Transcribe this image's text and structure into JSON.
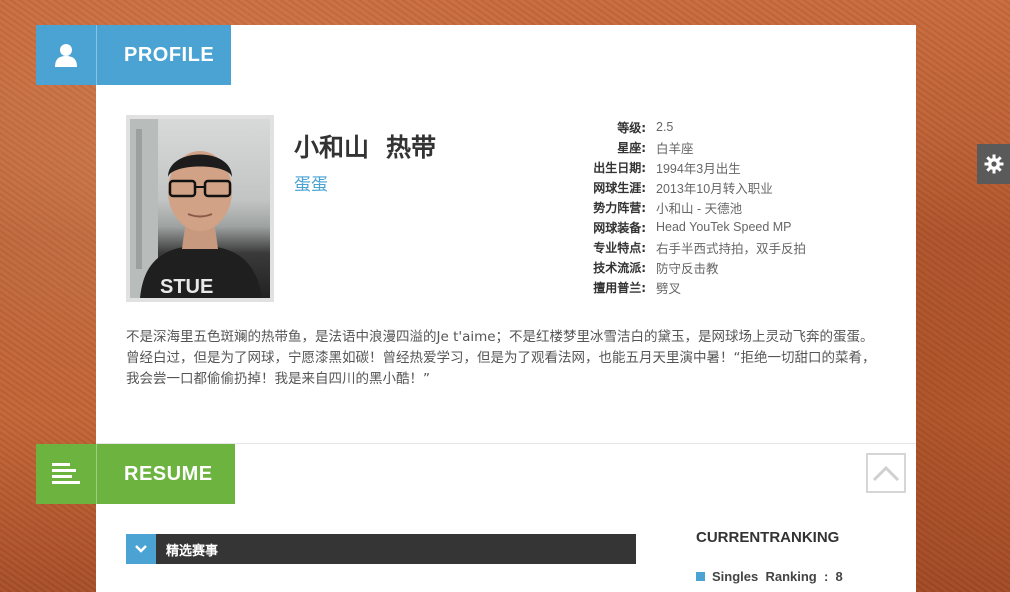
{
  "profile": {
    "tab_label": "PROFILE",
    "tab_icon": "user-icon",
    "name": "小和山",
    "alias": "热带",
    "nickname": "蛋蛋",
    "photo_icon": "avatar-photo",
    "info": [
      {
        "key": "等级:",
        "value": "2.5"
      },
      {
        "key": "星座:",
        "value": "白羊座"
      },
      {
        "key": "出生日期:",
        "value": "1994年3月出生"
      },
      {
        "key": "网球生涯:",
        "value": "2013年10月转入职业"
      },
      {
        "key": "势力阵营:",
        "value": "小和山 - 天德池"
      },
      {
        "key": "网球装备:",
        "value": "Head YouTek Speed MP"
      },
      {
        "key": "专业特点:",
        "value": "右手半西式持拍，双手反拍"
      },
      {
        "key": "技术流派:",
        "value": "防守反击教"
      },
      {
        "key": "擅用普兰:",
        "value": "劈叉"
      }
    ],
    "bio": "不是深海里五色斑斓的热带鱼，是法语中浪漫四溢的Je t'aime；不是红楼梦里冰雪洁白的黛玉，是网球场上灵动飞奔的蛋蛋。曾经白过，但是为了网球，宁愿漆黑如碳！曾经热爱学习，但是为了观看法网，也能五月天里演中暑！“拒绝一切甜口的菜肴，我会尝一口都偷偷扔掉！我是来自四川的黑小酷！”"
  },
  "resume": {
    "tab_label": "RESUME",
    "tab_icon": "align-left-icon",
    "events_label": "精选赛事",
    "events_icon": "chevron-down-icon",
    "ranking_title": "CURRENTRANKING",
    "ranking_items": [
      {
        "label": "Singles  Ranking  :  8"
      }
    ]
  },
  "controls": {
    "settings_icon": "gear-icon",
    "scroll_top_icon": "chevron-up-icon"
  },
  "colors": {
    "profile_accent": "#4aa3d3",
    "resume_accent": "#6cb33f",
    "dark_bar": "#353535"
  }
}
